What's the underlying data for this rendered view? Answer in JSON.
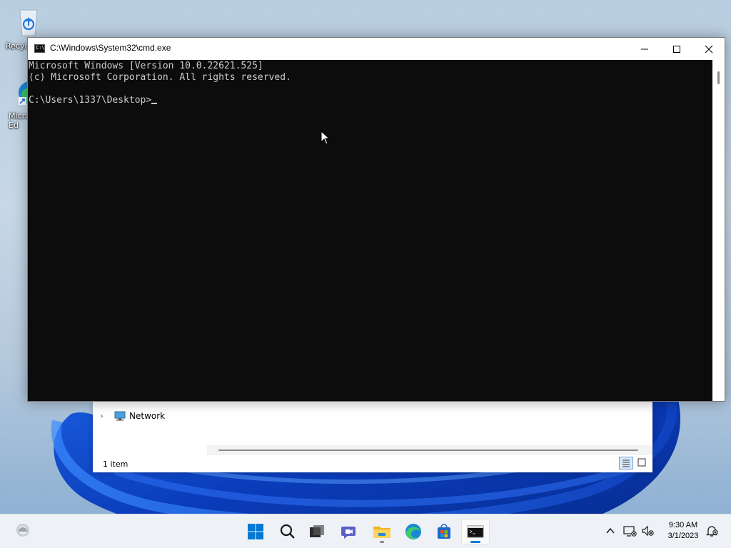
{
  "desktop": {
    "icons": [
      {
        "label": "Recyc",
        "icon": "recycle-bin-icon"
      },
      {
        "label": "Micro\nEd",
        "icon": "edge-shortcut-icon"
      }
    ]
  },
  "explorer": {
    "nav_item_label": "Network",
    "status_text": "1 item"
  },
  "cmd": {
    "title": "C:\\Windows\\System32\\cmd.exe",
    "lines": [
      "Microsoft Windows [Version 10.0.22621.525]",
      "(c) Microsoft Corporation. All rights reserved.",
      "",
      "C:\\Users\\1337\\Desktop>"
    ],
    "icon_text": "C:\\"
  },
  "taskbar": {
    "items": [
      {
        "name": "start-button",
        "icon": "windows-logo-icon"
      },
      {
        "name": "search-button",
        "icon": "search-icon"
      },
      {
        "name": "task-view-button",
        "icon": "task-view-icon"
      },
      {
        "name": "chat-button",
        "icon": "teams-chat-icon"
      },
      {
        "name": "file-explorer-button",
        "icon": "folder-icon"
      },
      {
        "name": "edge-button",
        "icon": "edge-icon"
      },
      {
        "name": "store-button",
        "icon": "store-icon"
      },
      {
        "name": "terminal-button",
        "icon": "cmd-icon"
      }
    ],
    "clock_time": "9:30 AM",
    "clock_date": "3/1/2023"
  },
  "colors": {
    "accent": "#0078d4",
    "console_bg": "#0c0c0c",
    "console_fg": "#cccccc"
  }
}
